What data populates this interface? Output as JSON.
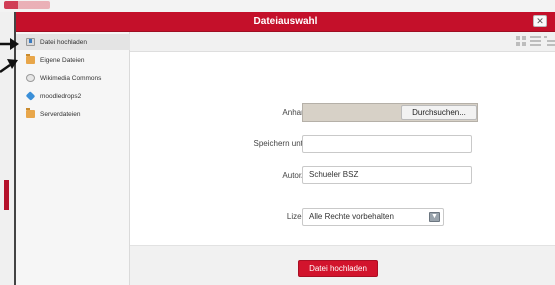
{
  "dialog": {
    "title": "Dateiauswahl",
    "close_label": "✕"
  },
  "sidebar": {
    "items": [
      {
        "label": "Datei hochladen",
        "icon": "upload-icon",
        "active": true
      },
      {
        "label": "Eigene Dateien",
        "icon": "folder-icon",
        "active": false
      },
      {
        "label": "Wikimedia Commons",
        "icon": "wikimedia-icon",
        "active": false
      },
      {
        "label": "moodledrops2",
        "icon": "dropbox-icon",
        "active": false
      },
      {
        "label": "Serverdateien",
        "icon": "folder-icon",
        "active": false
      }
    ]
  },
  "toolbar": {
    "views": [
      "grid-view-icon",
      "list-view-icon",
      "tree-view-icon"
    ]
  },
  "form": {
    "attachment_label": "Anhang",
    "browse_label": "Durchsuchen...",
    "save_as_label": "Speichern unter",
    "save_as_value": "",
    "author_label": "Autor/in",
    "author_value": "Schueler BSZ",
    "license_label": "Lizenz",
    "license_value": "Alle Rechte vorbehalten"
  },
  "footer": {
    "upload_label": "Datei hochladen"
  },
  "colors": {
    "accent": "#c4102a",
    "button": "#d2142d"
  }
}
